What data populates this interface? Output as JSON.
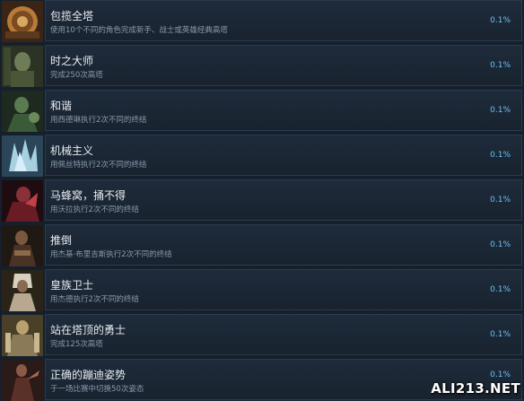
{
  "achievements": [
    {
      "title": "包揽全塔",
      "description": "使用10个不同的角色完成新手、战士或英雄经典高塔",
      "percent": "0.1%",
      "icon": "tower-medallion-icon",
      "color": "#a0622a"
    },
    {
      "title": "时之大师",
      "description": "完成250次高塔",
      "percent": "0.1%",
      "icon": "time-master-portrait-icon",
      "color": "#5c6b4a"
    },
    {
      "title": "和谐",
      "description": "用西德琳执行2次不同的终结",
      "percent": "0.1%",
      "icon": "harmony-portrait-icon",
      "color": "#3f5b3e"
    },
    {
      "title": "机械主义",
      "description": "用佩丝特执行2次不同的终结",
      "percent": "0.1%",
      "icon": "mechanism-portrait-icon",
      "color": "#8ab4c8"
    },
    {
      "title": "马蜂窝，捅不得",
      "description": "用沃拉执行2次不同的终结",
      "percent": "0.1%",
      "icon": "hornet-nest-portrait-icon",
      "color": "#7a2028"
    },
    {
      "title": "推倒",
      "description": "用杰基·布里吉斯执行2次不同的终结",
      "percent": "0.1%",
      "icon": "knockdown-portrait-icon",
      "color": "#5a4030"
    },
    {
      "title": "皇族卫士",
      "description": "用杰德执行2次不同的终结",
      "percent": "0.1%",
      "icon": "royal-guard-portrait-icon",
      "color": "#b8a890"
    },
    {
      "title": "站在塔顶的勇士",
      "description": "完成125次高塔",
      "percent": "0.1%",
      "icon": "tower-warrior-portrait-icon",
      "color": "#8a7a58"
    },
    {
      "title": "正确的蹦迪姿势",
      "description": "于一场比赛中切换50次姿态",
      "percent": "0.1%",
      "icon": "dance-stance-portrait-icon",
      "color": "#6a3a34"
    }
  ],
  "watermark": "ALI213.NET"
}
